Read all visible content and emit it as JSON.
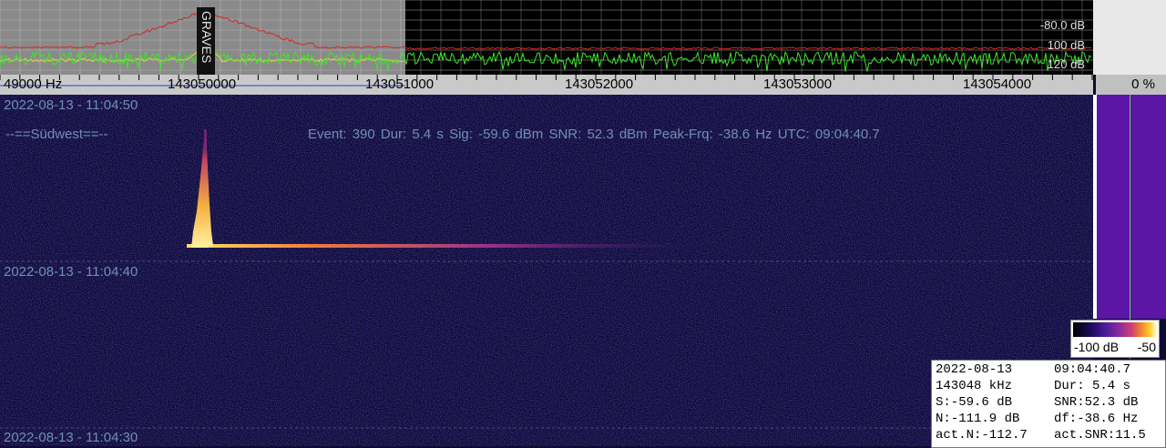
{
  "spectrum": {
    "db_labels": [
      "-80.0 dB",
      "100 dB",
      "120 dB"
    ],
    "callsign_overlay": "GRAVES"
  },
  "freq_axis": {
    "labels": [
      "49000 Hz",
      "143050000",
      "143051000",
      "143052000",
      "143053000",
      "143054000"
    ],
    "percent": "0 %"
  },
  "waterfall": {
    "timestamps": [
      "2022-08-13 - 11:04:50",
      "2022-08-13 - 11:04:40",
      "2022-08-13 - 11:04:30"
    ],
    "station": "--==Südwest==--",
    "event": "Event: 390   Dur: 5.4 s   Sig: -59.6 dBm   SNR: 52.3 dBm   Peak-Frq: -38.6 Hz   UTC: 09:04:40.7"
  },
  "colorbar": {
    "min_label": "-100 dB",
    "max_label": "-50"
  },
  "info": {
    "rows": [
      {
        "left": "2022-08-13",
        "right": "09:04:40.7"
      },
      {
        "left": "143048 kHz",
        "right": "Dur: 5.4 s"
      },
      {
        "left": "S:-59.6 dB",
        "right": "SNR:52.3 dB"
      },
      {
        "left": "N:-111.9 dB",
        "right": "df:-38.6 Hz"
      },
      {
        "left": "act.N:-112.7",
        "right": "act.SNR:11.5"
      }
    ]
  },
  "colors": {
    "spectrum_red": "#d22828",
    "spectrum_green": "#3ce62a",
    "spectrum_yellow": "#e6d23c",
    "waterfall_bg": "#0d0a33",
    "meteor_core": "#ffe066",
    "label_blue": "#6f8fb3"
  }
}
